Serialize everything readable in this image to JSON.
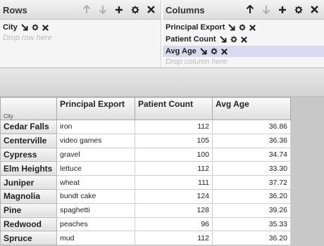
{
  "rows_panel": {
    "title": "Rows",
    "fields": [
      {
        "label": "City"
      }
    ],
    "drop_hint": "Drop row here"
  },
  "columns_panel": {
    "title": "Columns",
    "fields": [
      {
        "label": "Principal Export"
      },
      {
        "label": "Patient Count"
      },
      {
        "label": "Avg Age"
      }
    ],
    "drop_hint": "Drop column here"
  },
  "grid": {
    "row_header_label": "City",
    "column_headers": [
      "Principal Export",
      "Patient Count",
      "Avg Age"
    ],
    "rows": [
      {
        "city": "Cedar Falls",
        "export": "iron",
        "count": "112",
        "age": "36.86"
      },
      {
        "city": "Centerville",
        "export": "video games",
        "count": "105",
        "age": "36.36"
      },
      {
        "city": "Cypress",
        "export": "gravel",
        "count": "100",
        "age": "34.74"
      },
      {
        "city": "Elm Heights",
        "export": "lettuce",
        "count": "112",
        "age": "33.30"
      },
      {
        "city": "Juniper",
        "export": "wheat",
        "count": "111",
        "age": "37.72"
      },
      {
        "city": "Magnolia",
        "export": "bundt cake",
        "count": "124",
        "age": "36.20"
      },
      {
        "city": "Pine",
        "export": "spaghetti",
        "count": "128",
        "age": "39.26"
      },
      {
        "city": "Redwood",
        "export": "peaches",
        "count": "96",
        "age": "35.33"
      },
      {
        "city": "Spruce",
        "export": "mud",
        "count": "112",
        "age": "36.20"
      }
    ]
  },
  "icons": [
    "arrow-up-icon",
    "arrow-down-icon",
    "plus-icon",
    "gear-icon",
    "close-icon",
    "sort-arrow-icon"
  ],
  "colors": {
    "selected_field": "#d9d9f0",
    "drop_hint": "#bcbcbc",
    "disabled_icon": "#b0b0b0"
  }
}
